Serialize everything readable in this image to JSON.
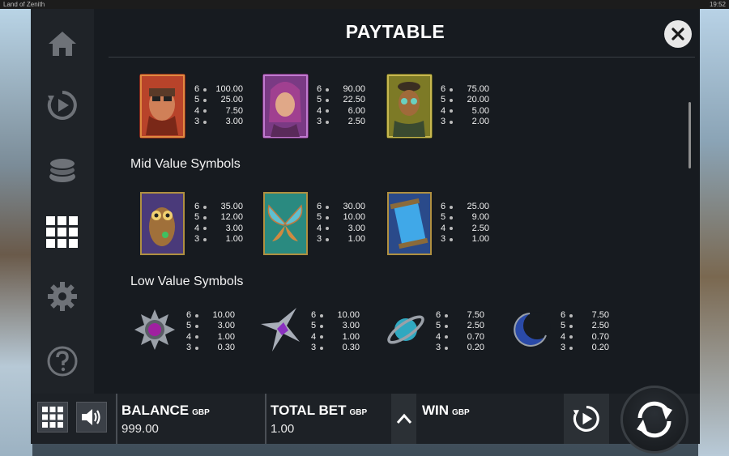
{
  "window": {
    "title": "Land of Zenith",
    "time": "19:52"
  },
  "paytable": {
    "title": "PAYTABLE",
    "high_value": [
      {
        "icon": "aviator-pilot-icon",
        "pays": [
          [
            "6",
            "100.00"
          ],
          [
            "5",
            "25.00"
          ],
          [
            "4",
            "7.50"
          ],
          [
            "3",
            "3.00"
          ]
        ]
      },
      {
        "icon": "purple-hair-woman-icon",
        "pays": [
          [
            "6",
            "90.00"
          ],
          [
            "5",
            "22.50"
          ],
          [
            "4",
            "6.00"
          ],
          [
            "3",
            "2.50"
          ]
        ]
      },
      {
        "icon": "masked-man-icon",
        "pays": [
          [
            "6",
            "75.00"
          ],
          [
            "5",
            "20.00"
          ],
          [
            "4",
            "5.00"
          ],
          [
            "3",
            "2.00"
          ]
        ]
      }
    ],
    "mid_title": "Mid Value Symbols",
    "mid_value": [
      {
        "icon": "owl-icon",
        "pays": [
          [
            "6",
            "35.00"
          ],
          [
            "5",
            "12.00"
          ],
          [
            "4",
            "3.00"
          ],
          [
            "3",
            "1.00"
          ]
        ]
      },
      {
        "icon": "butterfly-icon",
        "pays": [
          [
            "6",
            "30.00"
          ],
          [
            "5",
            "10.00"
          ],
          [
            "4",
            "3.00"
          ],
          [
            "3",
            "1.00"
          ]
        ]
      },
      {
        "icon": "scroll-icon",
        "pays": [
          [
            "6",
            "25.00"
          ],
          [
            "5",
            "9.00"
          ],
          [
            "4",
            "2.50"
          ],
          [
            "3",
            "1.00"
          ]
        ]
      }
    ],
    "low_title": "Low Value Symbols",
    "low_value": [
      {
        "icon": "sun-gem-icon",
        "pays": [
          [
            "6",
            "10.00"
          ],
          [
            "5",
            "3.00"
          ],
          [
            "4",
            "1.00"
          ],
          [
            "3",
            "0.30"
          ]
        ]
      },
      {
        "icon": "star-gem-icon",
        "pays": [
          [
            "6",
            "10.00"
          ],
          [
            "5",
            "3.00"
          ],
          [
            "4",
            "1.00"
          ],
          [
            "3",
            "0.30"
          ]
        ]
      },
      {
        "icon": "planet-gem-icon",
        "pays": [
          [
            "6",
            "7.50"
          ],
          [
            "5",
            "2.50"
          ],
          [
            "4",
            "0.70"
          ],
          [
            "3",
            "0.20"
          ]
        ]
      },
      {
        "icon": "moon-gem-icon",
        "pays": [
          [
            "6",
            "7.50"
          ],
          [
            "5",
            "2.50"
          ],
          [
            "4",
            "0.70"
          ],
          [
            "3",
            "0.20"
          ]
        ]
      }
    ]
  },
  "bottom": {
    "balance_label": "BALANCE",
    "balance_currency": "GBP",
    "balance_value": "999.00",
    "bet_label": "TOTAL BET",
    "bet_currency": "GBP",
    "bet_value": "1.00",
    "win_label": "WIN",
    "win_currency": "GBP"
  },
  "colors": {
    "panel": "#171b20",
    "sidebar": "#1f2328",
    "icon_inactive": "#6e7278",
    "icon_active": "#ffffff"
  }
}
